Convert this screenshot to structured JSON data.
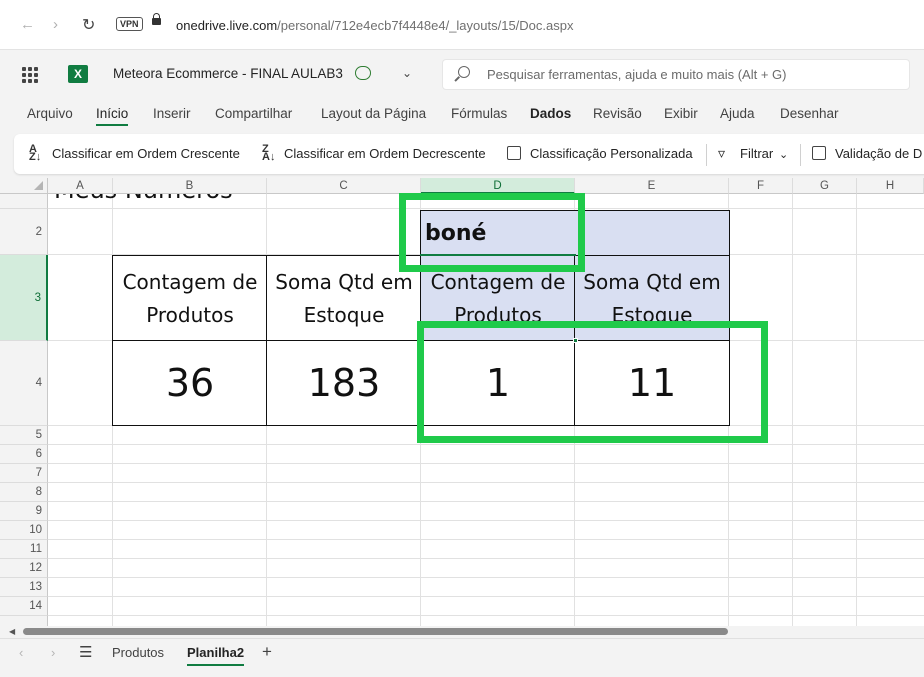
{
  "browser": {
    "back_icon": "back-arrow-icon",
    "forward_icon": "forward-arrow-icon",
    "reload_icon": "reload-icon",
    "vpn_label": "VPN",
    "url_host": "onedrive.live.com",
    "url_path": "/personal/712e4ecb7f4448e4/_layouts/15/Doc.aspx"
  },
  "app": {
    "doc_title": "Meteora Ecommerce - FINAL AULAB3",
    "logo_letter": "X",
    "search_placeholder": "Pesquisar ferramentas, ajuda e muito mais (Alt + G)"
  },
  "menu": {
    "tabs": [
      "Arquivo",
      "Início",
      "Inserir",
      "Compartilhar",
      "Layout da Página",
      "Fórmulas",
      "Dados",
      "Revisão",
      "Exibir",
      "Ajuda",
      "Desenhar"
    ]
  },
  "ribbon": {
    "sort_asc": "Classificar em Ordem Crescente",
    "sort_desc": "Classificar em Ordem Decrescente",
    "custom_sort": "Classificação Personalizada",
    "filter": "Filtrar",
    "validation": "Validação de D"
  },
  "grid": {
    "columns": [
      "A",
      "B",
      "C",
      "D",
      "E",
      "F",
      "G",
      "H"
    ],
    "rows": [
      "2",
      "3",
      "4",
      "5",
      "6",
      "7",
      "8",
      "9",
      "10",
      "11",
      "12",
      "13",
      "14"
    ],
    "partial_title": "Meus Números",
    "filter_label": "boné",
    "header_b": "Contagem de Produtos",
    "header_c": "Soma Qtd em Estoque",
    "header_d": "Contagem de Produtos",
    "header_e": "Soma Qtd em Estoque",
    "val_b": "36",
    "val_c": "183",
    "val_d": "1",
    "val_e": "11"
  },
  "sheets": {
    "tabs": [
      "Produtos",
      "Planilha2"
    ],
    "active": "Planilha2",
    "add_label": "+"
  },
  "colors": {
    "accent": "#107c41",
    "highlight": "#1fca4a",
    "pivot_fill": "#d9dff2"
  }
}
